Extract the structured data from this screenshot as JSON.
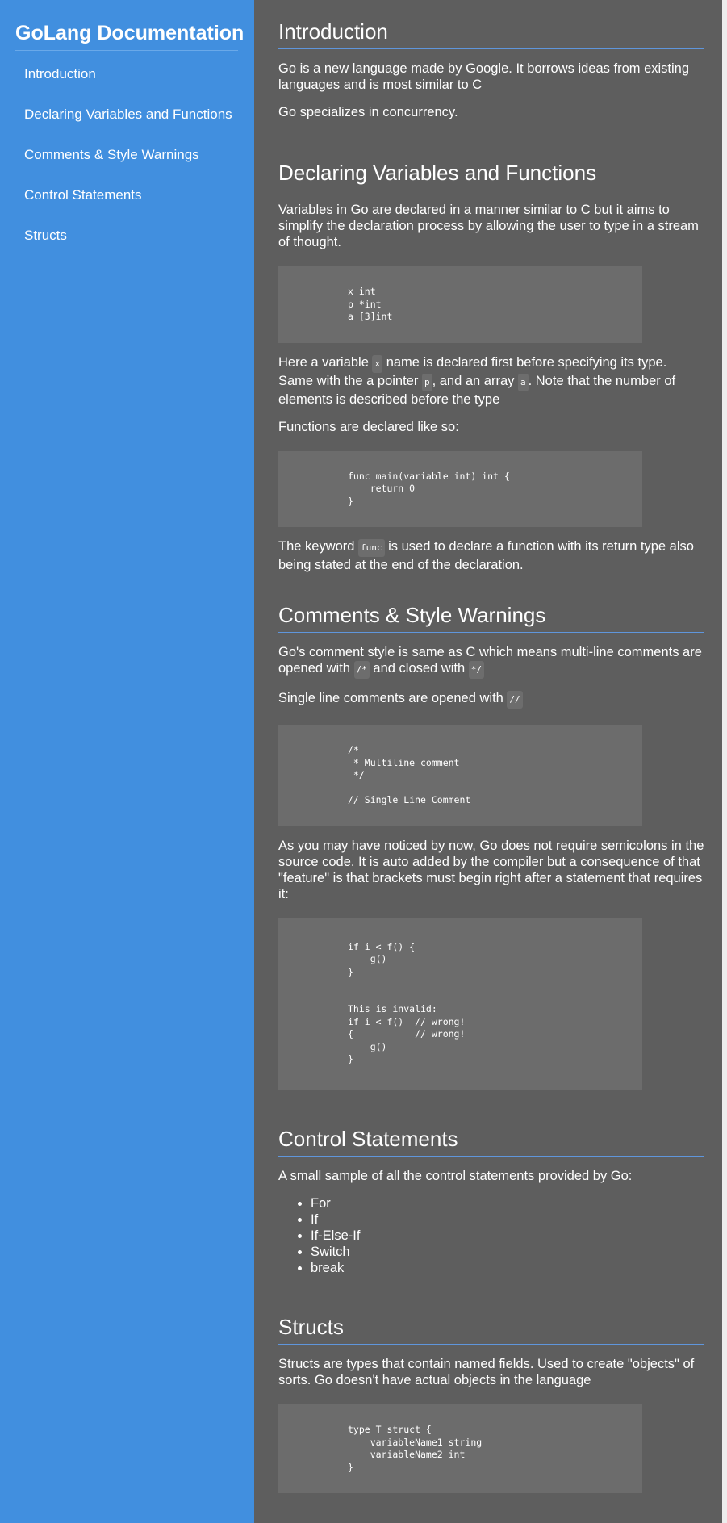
{
  "nav": {
    "title": "GoLang Documentation",
    "items": [
      {
        "label": "Introduction"
      },
      {
        "label": "Declaring Variables and Functions"
      },
      {
        "label": "Comments & Style Warnings"
      },
      {
        "label": "Control Statements"
      },
      {
        "label": "Structs"
      }
    ]
  },
  "intro": {
    "heading": "Introduction",
    "p1": "Go is a new language made by Google. It borrows ideas from existing languages and is most similar to C",
    "p2": "Go specializes in concurrency."
  },
  "declaring": {
    "heading": "Declaring Variables and Functions",
    "p1": "Variables in Go are declared in a manner similar to C but it aims to simplify the declaration process by allowing the user to type in a stream of thought.",
    "code1": "x int\np *int\na [3]int",
    "p2_a": "Here a variable ",
    "p2_code_x": "x",
    "p2_b": " name is declared first before specifying its type. Same with the a pointer ",
    "p2_code_p": "p",
    "p2_c": ", and an array ",
    "p2_code_a": "a",
    "p2_d": ". Note that the number of elements is described before the type",
    "p3": "Functions are declared like so:",
    "code2": "func main(variable int) int {\n    return 0\n}",
    "p4_a": "The keyword ",
    "p4_code": "func",
    "p4_b": " is used to declare a function with its return type also being stated at the end of the declaration."
  },
  "comments": {
    "heading": "Comments & Style Warnings",
    "p1_a": "Go's comment style is same as C which means multi-line comments are opened with ",
    "p1_code_open": "/*",
    "p1_b": " and closed with ",
    "p1_code_close": "*/",
    "p2_a": "Single line comments are opened with ",
    "p2_code": "//",
    "code1": "/*\n * Multiline comment\n */\n\n// Single Line Comment",
    "p3": "As you may have noticed by now, Go does not require semicolons in the source code. It is auto added by the compiler but a consequence of that \"feature\" is that brackets must begin right after a statement that requires it:",
    "code2": "if i < f() {\n    g()\n}\n\n\nThis is invalid:\nif i < f()  // wrong!\n{           // wrong!\n    g()\n}"
  },
  "control": {
    "heading": "Control Statements",
    "p1": "A small sample of all the control statements provided by Go:",
    "items": [
      "For",
      "If",
      "If-Else-If",
      "Switch",
      "break"
    ]
  },
  "structs": {
    "heading": "Structs",
    "p1": "Structs are types that contain named fields. Used to create \"objects\" of sorts. Go doesn't have actual objects in the language",
    "code1": "type T struct {\n    variableName1 string\n    variableName2 int\n}"
  },
  "colors": {
    "nav_background": "#418fdf",
    "main_background": "#5e5e5e",
    "code_background": "#6c6c6c",
    "heading_rule": "#5f96dc"
  }
}
